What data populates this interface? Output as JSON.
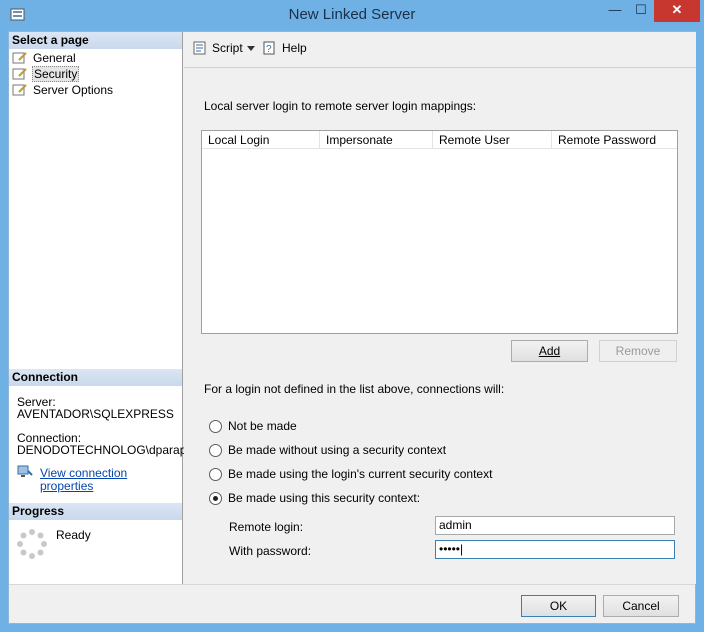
{
  "window": {
    "title": "New Linked Server"
  },
  "left": {
    "select_header": "Select a page",
    "pages": [
      {
        "label": "General"
      },
      {
        "label": "Security"
      },
      {
        "label": "Server Options"
      }
    ],
    "connection_header": "Connection",
    "server_label": "Server:",
    "server_value": "AVENTADOR\\SQLEXPRESS",
    "connection_label": "Connection:",
    "connection_value": "DENODOTECHNOLOG\\dparapar",
    "view_props_link": "View connection properties",
    "progress_header": "Progress",
    "progress_status": "Ready"
  },
  "toolbar": {
    "script_label": "Script",
    "help_label": "Help"
  },
  "main": {
    "mappings_label": "Local server login to remote server login mappings:",
    "columns": [
      "Local Login",
      "Impersonate",
      "Remote User",
      "Remote Password"
    ],
    "add_label": "Add",
    "remove_label": "Remove",
    "connections_label": "For a login not defined in the list above, connections will:",
    "options": [
      {
        "label": "Not be made",
        "checked": false
      },
      {
        "label": "Be made without using a security context",
        "checked": false
      },
      {
        "label": "Be made using the login's current security context",
        "checked": false
      },
      {
        "label": "Be made using this security context:",
        "checked": true
      }
    ],
    "remote_login_label": "Remote login:",
    "remote_login_value": "admin",
    "password_label": "With password:",
    "password_value": "•••••|"
  },
  "footer": {
    "ok_label": "OK",
    "cancel_label": "Cancel"
  }
}
